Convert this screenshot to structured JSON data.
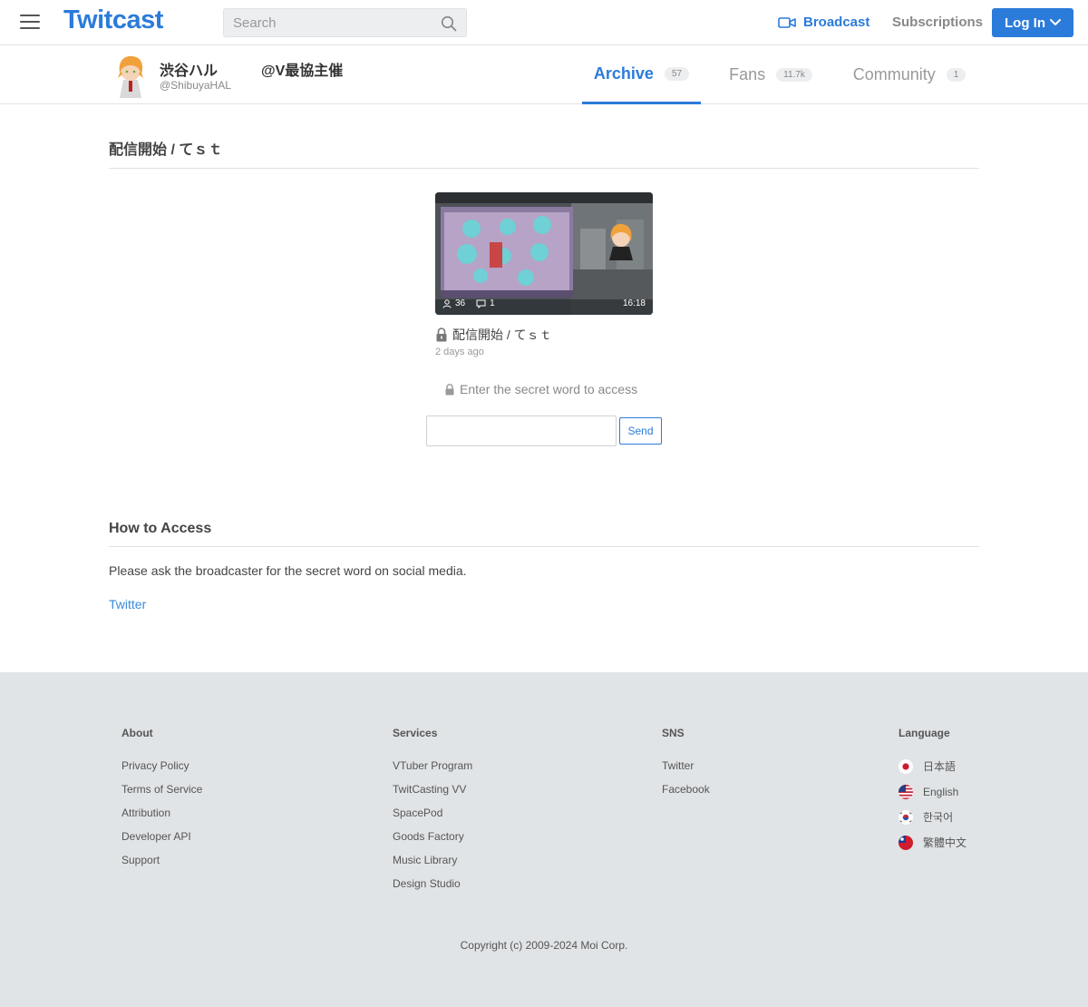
{
  "header": {
    "logo": "Twitcast",
    "search_placeholder": "Search",
    "broadcast_label": "Broadcast",
    "subscriptions_label": "Subscriptions",
    "login_label": "Log In",
    "accent_color": "#2b7bda"
  },
  "profile": {
    "name": "渋谷ハル   @V最協主催",
    "handle": "@ShibuyaHAL",
    "tabs": [
      {
        "label": "Archive",
        "count": "57",
        "active": true
      },
      {
        "label": "Fans",
        "count": "11.7k",
        "active": false
      },
      {
        "label": "Community",
        "count": "1",
        "active": false
      }
    ]
  },
  "movie": {
    "section_title": "配信開始 / てｓｔ",
    "title": "配信開始 / てｓｔ",
    "date": "2 days ago",
    "viewers": "36",
    "comments": "1",
    "duration": "16:18",
    "secret_prompt": "Enter the secret word to access",
    "send_label": "Send"
  },
  "howto": {
    "title": "How to Access",
    "text": "Please ask the broadcaster for the secret word on social media.",
    "link": "Twitter"
  },
  "footer": {
    "about": {
      "heading": "About",
      "links": [
        "Privacy Policy",
        "Terms of Service",
        "Attribution",
        "Developer API",
        "Support"
      ]
    },
    "services": {
      "heading": "Services",
      "links": [
        "VTuber Program",
        "TwitCasting VV",
        "SpacePod",
        "Goods Factory",
        "Music Library",
        "Design Studio"
      ]
    },
    "sns": {
      "heading": "SNS",
      "links": [
        "Twitter",
        "Facebook"
      ]
    },
    "language": {
      "heading": "Language",
      "items": [
        "日本語",
        "English",
        "한국어",
        "繁體中文"
      ]
    },
    "copyright": "Copyright (c) 2009-2024 Moi Corp."
  }
}
